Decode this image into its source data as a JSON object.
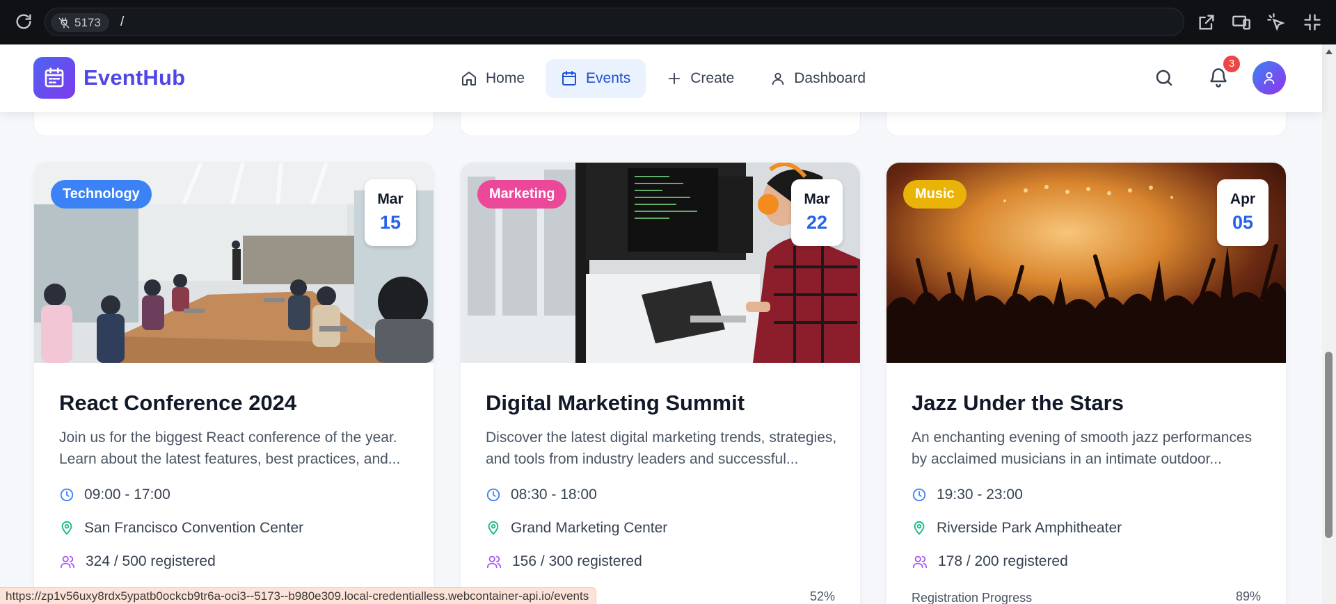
{
  "browser": {
    "port": "5173",
    "path": "/"
  },
  "header": {
    "brand": "EventHub",
    "nav": [
      {
        "label": "Home",
        "icon": "home-icon"
      },
      {
        "label": "Events",
        "icon": "calendar-icon",
        "active": true
      },
      {
        "label": "Create",
        "icon": "plus-icon"
      },
      {
        "label": "Dashboard",
        "icon": "user-icon"
      }
    ],
    "notification_count": "3"
  },
  "colors": {
    "brand": "#4f46e5",
    "technology": "#3b82f6",
    "marketing": "#ec4899",
    "music": "#eab308",
    "clock": "#3b82f6",
    "location": "#10b981",
    "users": "#a855f7"
  },
  "events": [
    {
      "category": "Technology",
      "month": "Mar",
      "day": "15",
      "title": "React Conference 2024",
      "desc_line1": "Join us for the biggest React conference of the year.",
      "desc_line2": "Learn about the latest features, best practices, and...",
      "time": "09:00 - 17:00",
      "location": "San Francisco Convention Center",
      "registered": "324 / 500 registered",
      "progress_label": "",
      "progress_pct": ""
    },
    {
      "category": "Marketing",
      "month": "Mar",
      "day": "22",
      "title": "Digital Marketing Summit",
      "desc_line1": "Discover the latest digital marketing trends, strategies,",
      "desc_line2": "and tools from industry leaders and successful...",
      "time": "08:30 - 18:00",
      "location": "Grand Marketing Center",
      "registered": "156 / 300 registered",
      "progress_label": "",
      "progress_pct": "52%"
    },
    {
      "category": "Music",
      "month": "Apr",
      "day": "05",
      "title": "Jazz Under the Stars",
      "desc_line1": "An enchanting evening of smooth jazz performances",
      "desc_line2": "by acclaimed musicians in an intimate outdoor...",
      "time": "19:30 - 23:00",
      "location": "Riverside Park Amphitheater",
      "registered": "178 / 200 registered",
      "progress_label": "Registration Progress",
      "progress_pct": "89%"
    }
  ],
  "status_url": "https://zp1v56uxy8rdx5ypatb0ockcb9tr6a-oci3--5173--b980e309.local-credentialless.webcontainer-api.io/events"
}
